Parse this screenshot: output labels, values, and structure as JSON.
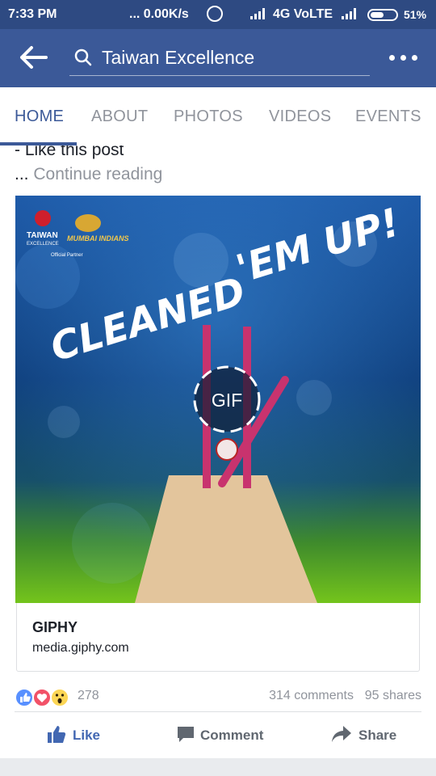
{
  "status_bar": {
    "time": "7:33 PM",
    "network_speed": "... 0.00K/s",
    "network_type": "4G VoLTE",
    "battery": "51%",
    "battery_level": 0.51
  },
  "app_bar": {
    "search_text": "Taiwan Excellence",
    "icons": [
      "back-arrow-icon",
      "search-icon",
      "more-icon"
    ]
  },
  "tabs": [
    {
      "label": "HOME",
      "active": true
    },
    {
      "label": "ABOUT",
      "active": false
    },
    {
      "label": "PHOTOS",
      "active": false
    },
    {
      "label": "VIDEOS",
      "active": false
    },
    {
      "label": "EVENTS",
      "active": false
    }
  ],
  "post": {
    "text_line": "-  Like this post",
    "continue_prefix": "...",
    "continue_label": "Continue reading",
    "media": {
      "headline_1": "CLEANED",
      "headline_2": "'EM UP!",
      "brand_1": "TAIWAN",
      "brand_2": "EXCELLENCE",
      "partner_note": "Official Partner",
      "team_logo_text": "MUMBAI INDIANS",
      "gif_badge": "GIF"
    },
    "link_card": {
      "title": "GIPHY",
      "domain": "media.giphy.com"
    },
    "reactions": {
      "types": [
        "like-icon",
        "love-icon",
        "wow-icon"
      ],
      "count": "278",
      "comments": "314 comments",
      "shares": "95 shares"
    },
    "actions": {
      "like": "Like",
      "comment": "Comment",
      "share": "Share"
    }
  },
  "colors": {
    "brand_blue": "#3b5998",
    "status_bar": "#2e4a82",
    "link_blue": "#4267b2",
    "stump_pink": "#c8336e"
  }
}
